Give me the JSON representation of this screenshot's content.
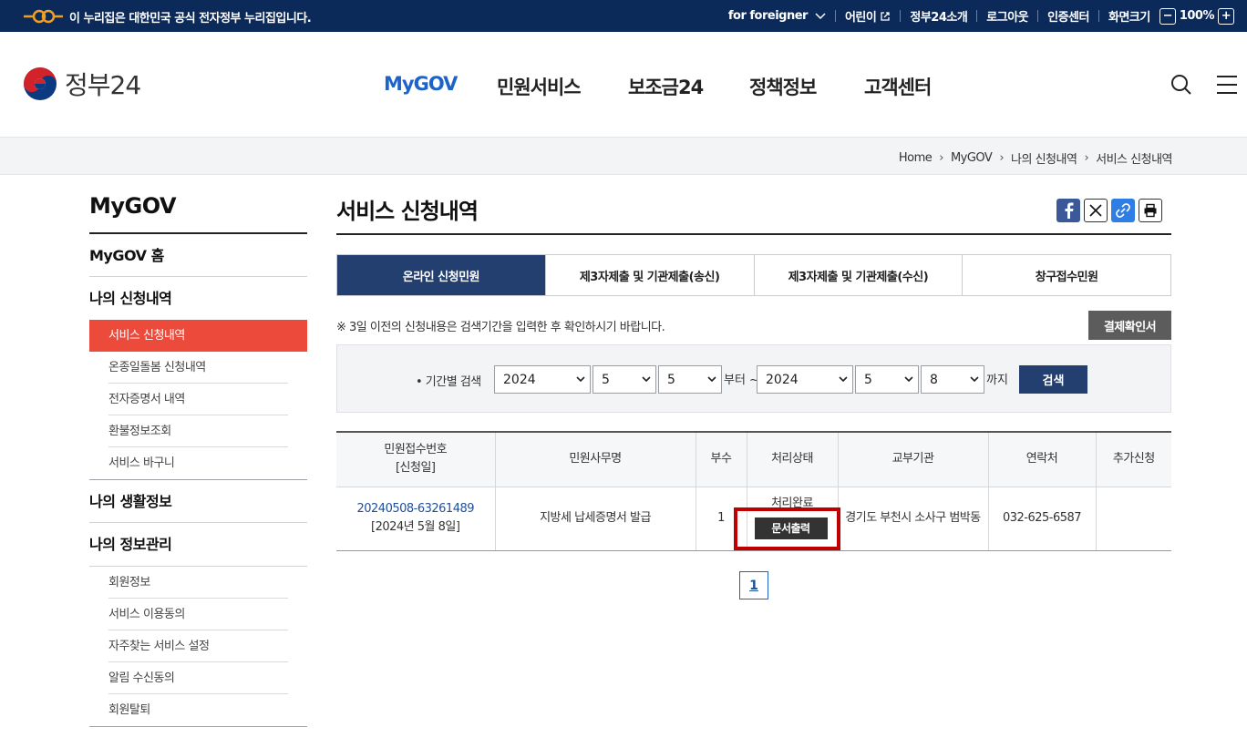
{
  "topbar": {
    "notice": "이 누리집은 대한민국 공식 전자정부 누리집입니다.",
    "links": [
      "for foreigner",
      "어린이",
      "정부24소개",
      "로그아웃",
      "인증센터",
      "화면크기"
    ],
    "zoom": "100%",
    "zoom_minus": "−",
    "zoom_plus": "+"
  },
  "header": {
    "logo_text": "정부24",
    "menu": [
      "MyGOV",
      "민원서비스",
      "보조금24",
      "정책정보",
      "고객센터"
    ],
    "active_menu": "MyGOV"
  },
  "breadcrumb": [
    "Home",
    "MyGOV",
    "나의 신청내역",
    "서비스 신청내역"
  ],
  "sidebar": {
    "title": "MyGOV",
    "home": "MyGOV 홈",
    "group1": "나의 신청내역",
    "group1_items": [
      "서비스 신청내역",
      "온종일돌봄 신청내역",
      "전자증명서 내역",
      "환불정보조회",
      "서비스 바구니"
    ],
    "group2": "나의 생활정보",
    "group3": "나의 정보관리",
    "group3_items": [
      "회원정보",
      "서비스 이용동의",
      "자주찾는 서비스 설정",
      "알림 수신동의",
      "회원탈퇴"
    ]
  },
  "content": {
    "title": "서비스 신청내역",
    "tabs": [
      "온라인 신청민원",
      "제3자제출 및 기관제출(송신)",
      "제3자제출 및 기관제출(수신)",
      "창구접수민원"
    ],
    "notice": "※ 3일 이전의 신청내용은 검색기간을 입력한 후 확인하시기 바랍니다.",
    "pay_confirm_btn": "결제확인서",
    "search": {
      "label": "• 기간별 검색",
      "from_year": "2024",
      "from_month": "5",
      "from_day": "5",
      "from_text": "부터 ~",
      "to_year": "2024",
      "to_month": "5",
      "to_day": "8",
      "to_text": "까지",
      "button": "검색"
    },
    "table": {
      "headers": [
        "민원접수번호",
        "[신청일]",
        "민원사무명",
        "부수",
        "처리상태",
        "교부기관",
        "연락처",
        "추가신청"
      ],
      "rows": [
        {
          "receipt_no": "20240508-63261489",
          "date": "[2024년 5월 8일]",
          "service": "지방세 납세증명서 발급",
          "copies": "1",
          "status": "처리완료",
          "doc_btn": "문서출력",
          "agency": "경기도 부천시 소사구 범박동",
          "contact": "032-625-6587",
          "extra": ""
        }
      ]
    },
    "page": "1"
  },
  "colors": {
    "navy": "#0b2a5a",
    "accent_blue": "#1e64c8",
    "active_tab": "#233f6f",
    "sidebar_active": "#ec4a3a",
    "highlight_red": "#c00000"
  }
}
